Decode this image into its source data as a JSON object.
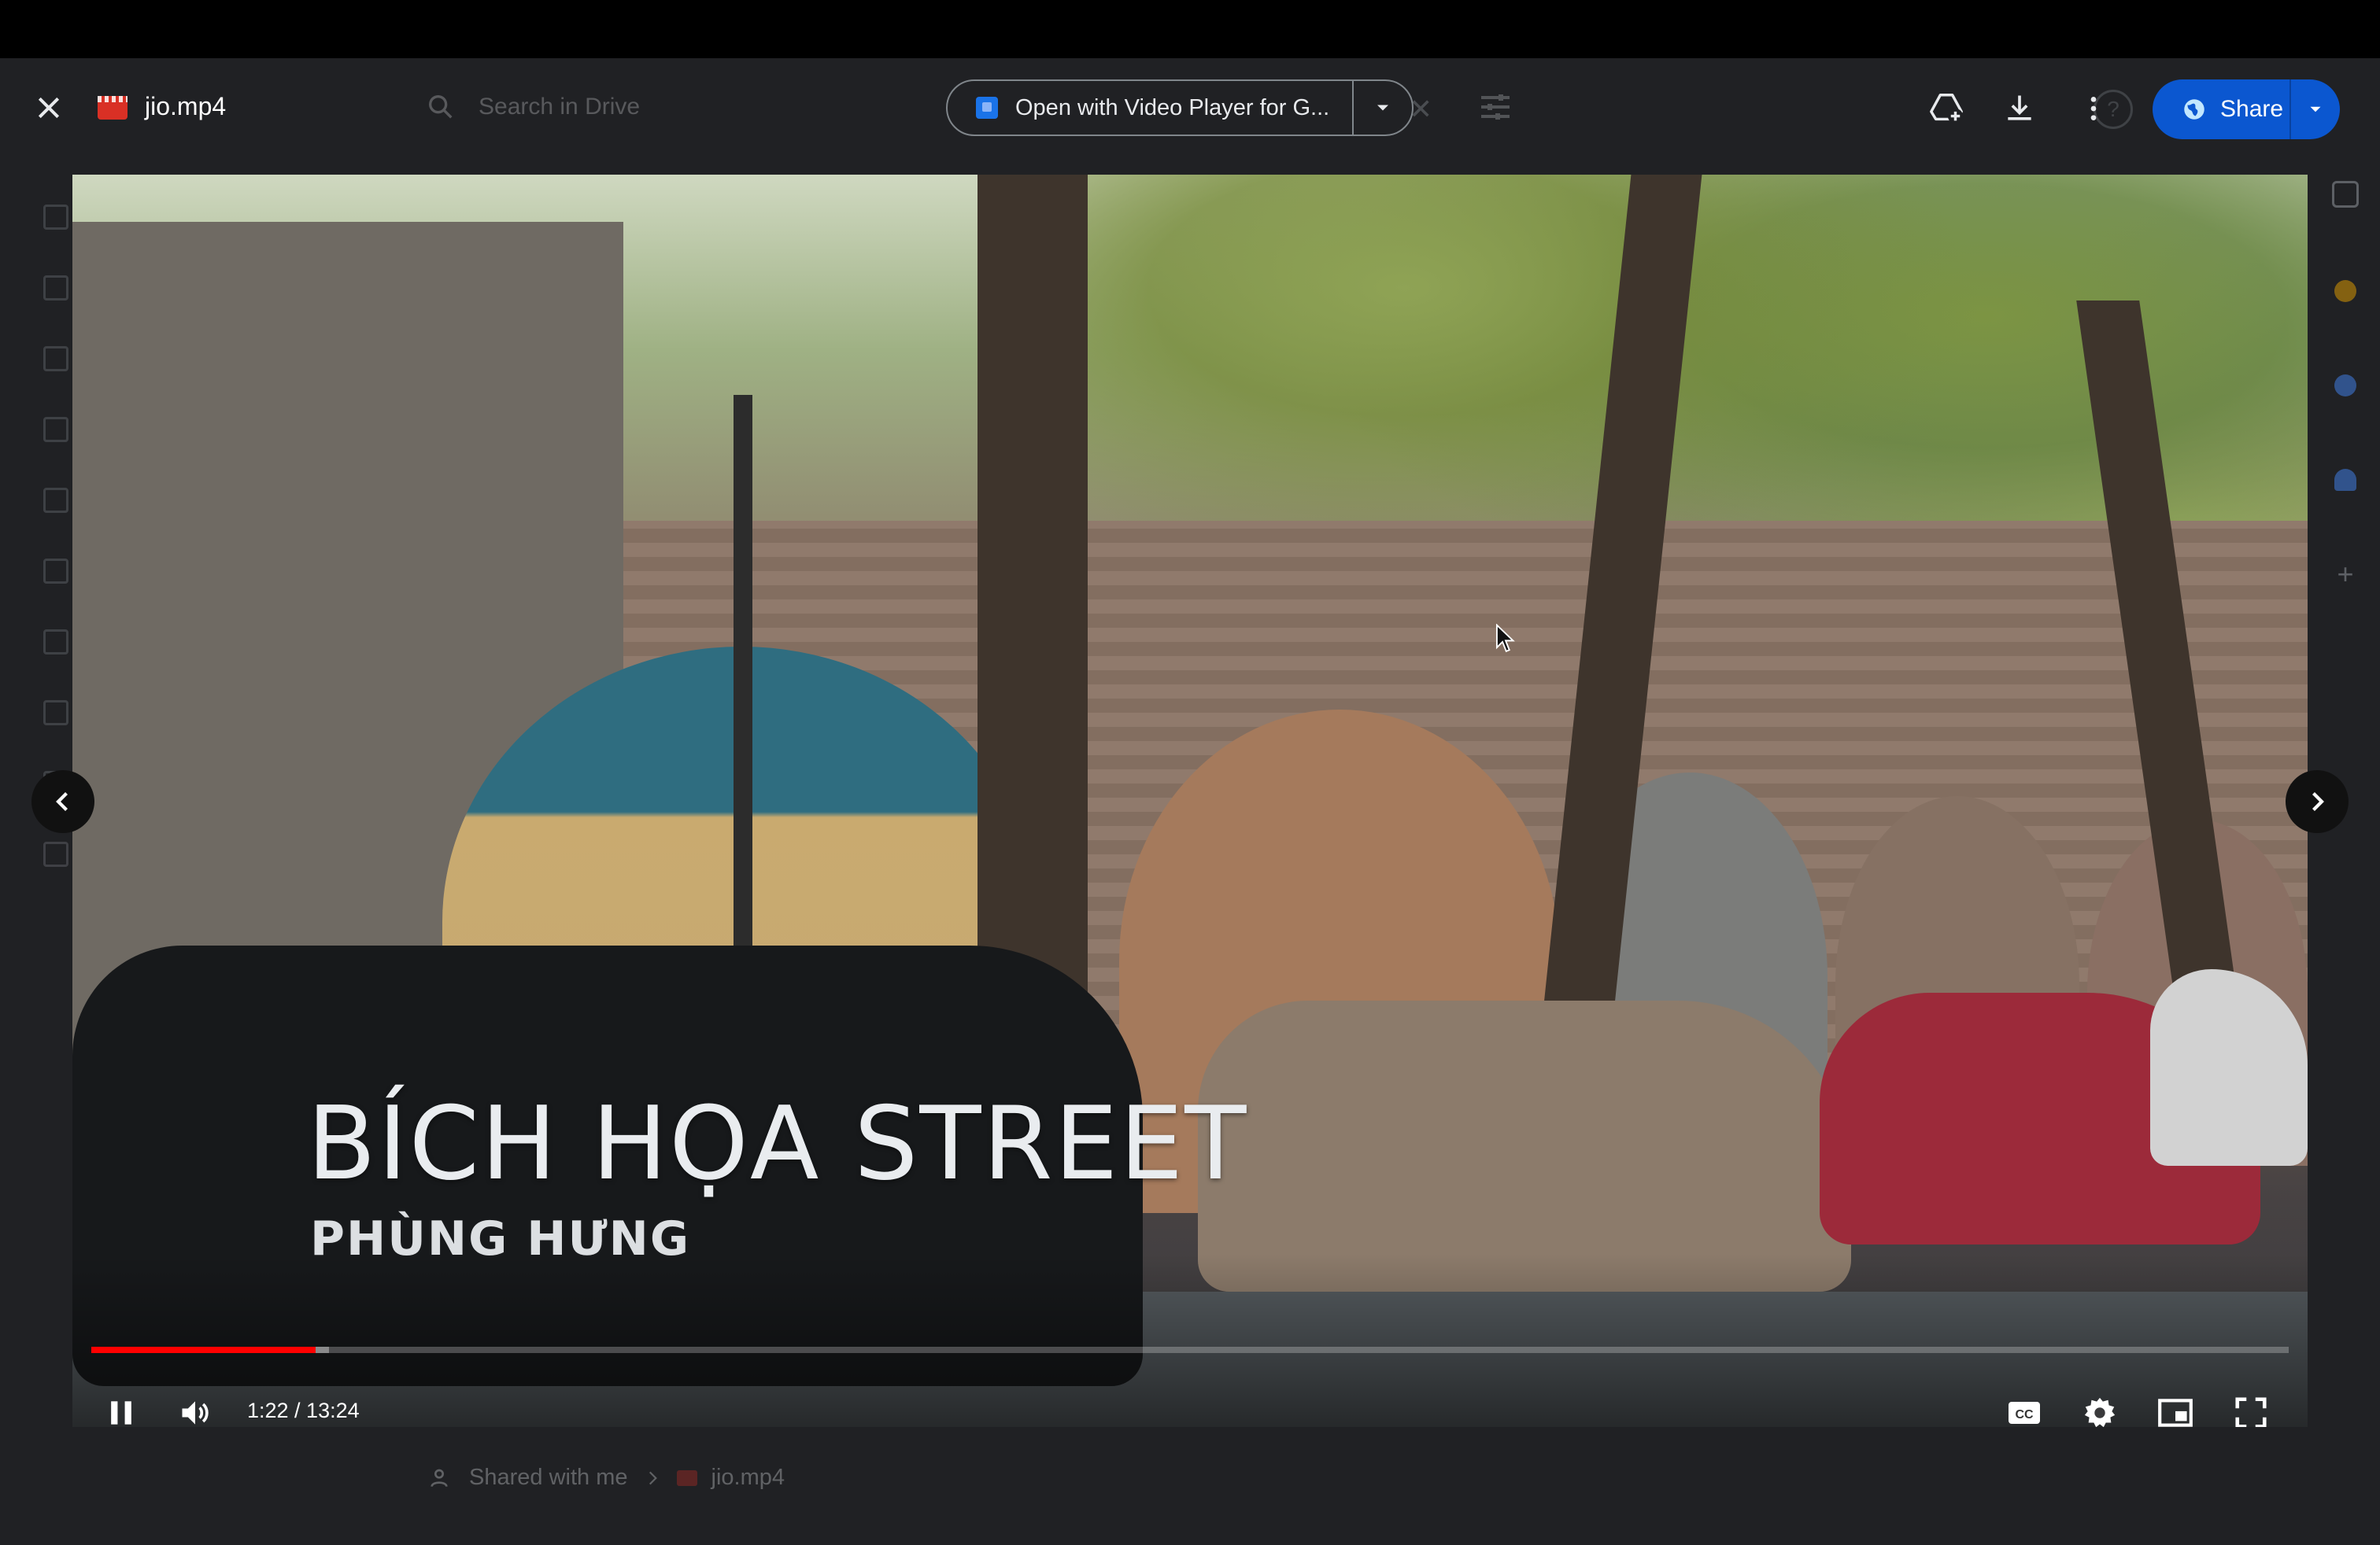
{
  "header": {
    "file_name": "jio.mp4",
    "search_placeholder": "Search in Drive",
    "open_with_label": "Open with Video Player for G...",
    "share_label": "Share",
    "colors": {
      "share_button": "#0b57d0",
      "file_icon": "#d93025"
    }
  },
  "icons": {
    "close": "close-icon",
    "add_to_drive": "add-to-drive-icon",
    "download": "download-icon",
    "more": "more-vert-icon",
    "share_globe": "globe-icon"
  },
  "video": {
    "title_overlay": "BÍCH HỌA STREET",
    "subtitle_overlay": "PHÙNG HƯNG",
    "current_time": "1:22",
    "duration": "13:24",
    "time_display": "1:22 / 13:24",
    "progress_fraction": 0.102,
    "buffered_fraction": 0.108,
    "state": "playing",
    "colors": {
      "progress": "#ff0000"
    }
  },
  "breadcrumb": {
    "items": [
      "Shared with me",
      "jio.mp4"
    ]
  }
}
